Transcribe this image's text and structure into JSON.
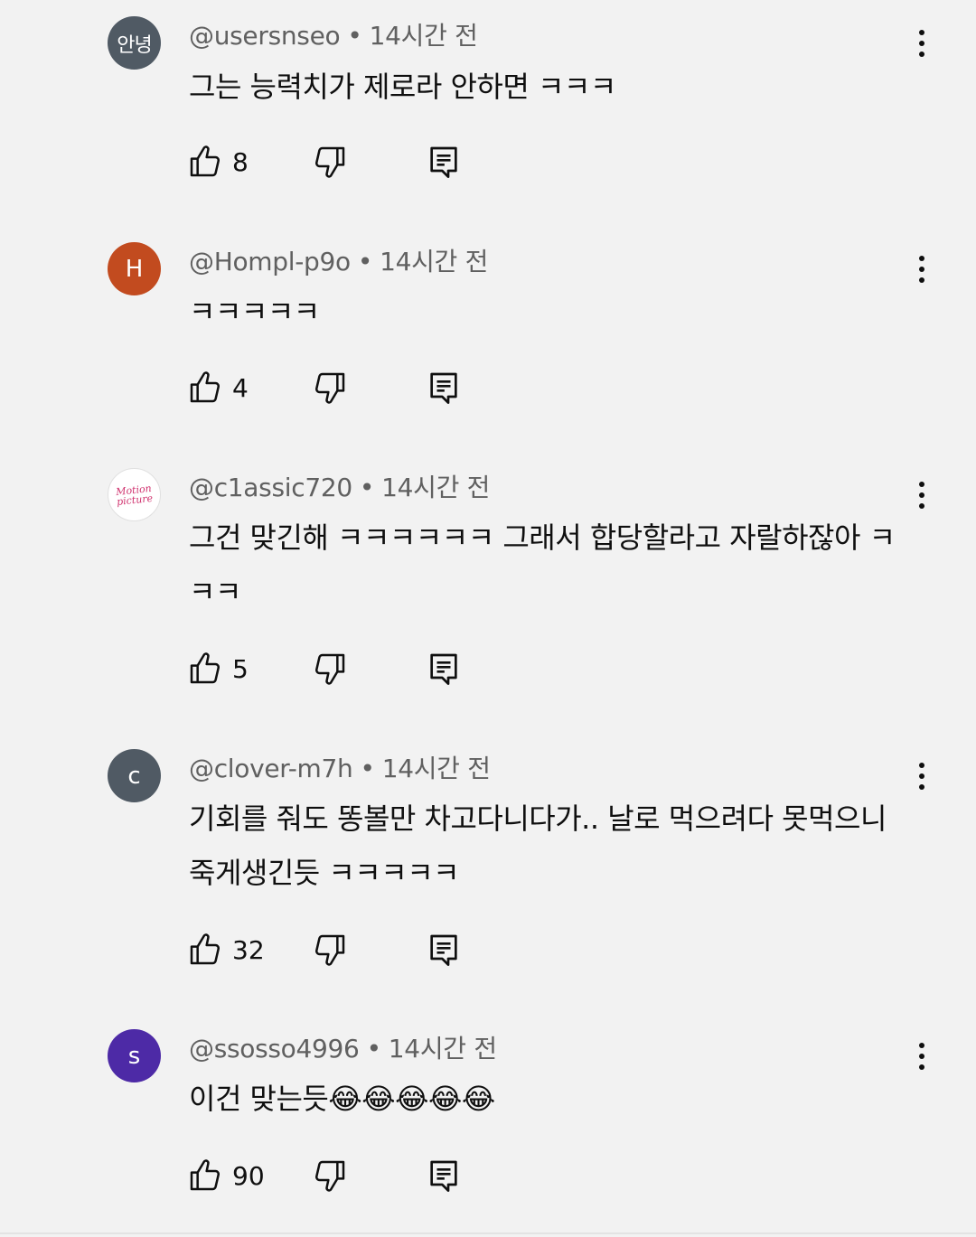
{
  "comments": [
    {
      "avatar_text": "안녕",
      "avatar_color": "#505a64",
      "author": "@usersnseo",
      "time": "14시간 전",
      "text": "그는 능력치가 제로라 안하면 ㅋㅋㅋ",
      "likes": "8"
    },
    {
      "avatar_text": "H",
      "avatar_color": "#c24b1f",
      "author": "@Hompl-p9o",
      "time": "14시간 전",
      "text": "ㅋㅋㅋㅋㅋ",
      "likes": "4"
    },
    {
      "avatar_text": "Motion picture",
      "avatar_color": "#ffffff",
      "author": "@c1assic720",
      "time": "14시간 전",
      "text": "그건 맞긴해 ㅋㅋㅋㅋㅋㅋ 그래서 합당할라고 자랄하잖아 ㅋㅋㅋ",
      "likes": "5"
    },
    {
      "avatar_text": "c",
      "avatar_color": "#505a64",
      "author": "@clover-m7h",
      "time": "14시간 전",
      "text": "기회를 줘도 똥볼만 차고다니다가.. 날로 먹으려다 못먹으니 죽게생긴듯 ㅋㅋㅋㅋㅋ",
      "likes": "32"
    },
    {
      "avatar_text": "s",
      "avatar_color": "#4d2aa6",
      "author": "@ssosso4996",
      "time": "14시간 전",
      "text": "이건 맞는듯😂😂😂😂😂",
      "likes": "90"
    }
  ],
  "separator": "•",
  "icons": {
    "like": "thumbs-up-icon",
    "dislike": "thumbs-down-icon",
    "reply": "reply-icon",
    "more": "more-vert-icon"
  }
}
